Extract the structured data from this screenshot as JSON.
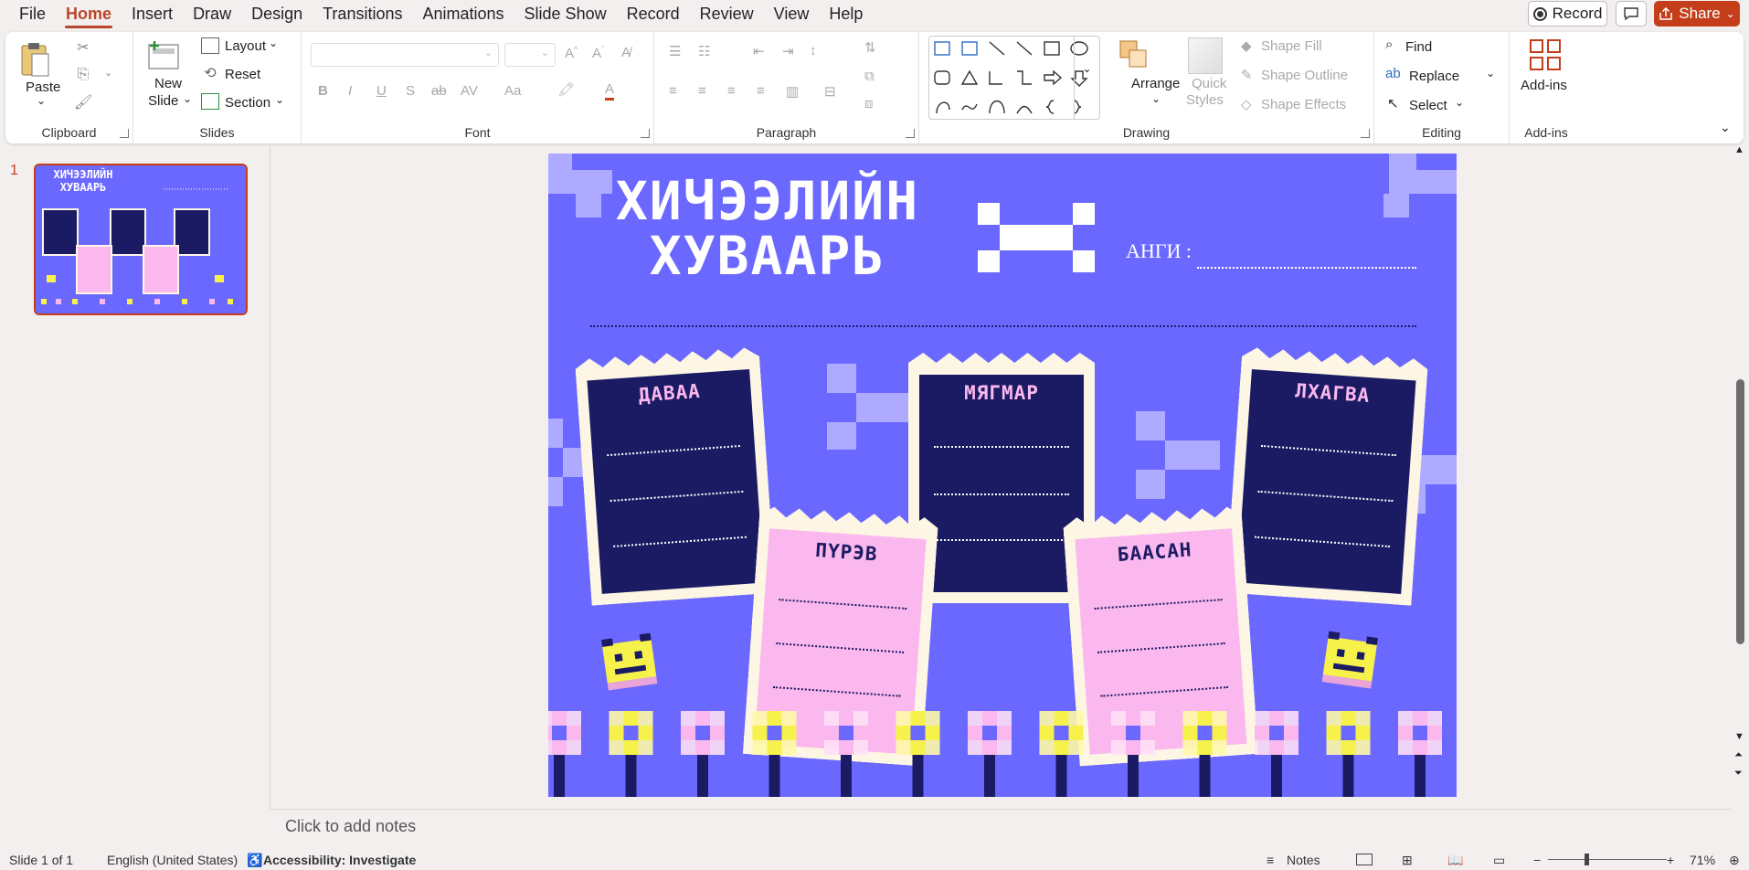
{
  "menu": {
    "tabs": [
      "File",
      "Home",
      "Insert",
      "Draw",
      "Design",
      "Transitions",
      "Animations",
      "Slide Show",
      "Record",
      "Review",
      "View",
      "Help"
    ],
    "active": "Home",
    "record_label": "Record",
    "share_label": "Share"
  },
  "ribbon": {
    "clipboard": {
      "label": "Clipboard",
      "paste": "Paste"
    },
    "slides": {
      "label": "Slides",
      "new_slide_1": "New",
      "new_slide_2": "Slide",
      "layout": "Layout",
      "reset": "Reset",
      "section": "Section"
    },
    "font": {
      "label": "Font",
      "bold": "B",
      "italic": "I",
      "underline": "U",
      "strike": "S",
      "abc": "ab",
      "av": "AV",
      "aa": "Aa"
    },
    "paragraph": {
      "label": "Paragraph"
    },
    "drawing": {
      "label": "Drawing",
      "arrange": "Arrange",
      "quick_styles_1": "Quick",
      "quick_styles_2": "Styles",
      "shape_fill": "Shape Fill",
      "shape_outline": "Shape Outline",
      "shape_effects": "Shape Effects"
    },
    "editing": {
      "label": "Editing",
      "find": "Find",
      "replace": "Replace",
      "select": "Select"
    },
    "addins": {
      "label": "Add-ins",
      "button": "Add-ins"
    }
  },
  "thumbnail": {
    "number": "1"
  },
  "slide": {
    "title_line1": "ХИЧЭЭЛИЙН",
    "title_line2": "ХУВААРЬ",
    "class_label": "АНГИ :",
    "days": [
      "ДАВАА",
      "МЯГМАР",
      "ЛХАГВА",
      "ПҮРЭВ",
      "БААСАН"
    ]
  },
  "notes": {
    "placeholder": "Click to add notes"
  },
  "status": {
    "slide_info": "Slide 1 of 1",
    "language": "English (United States)",
    "accessibility": "Accessibility: Investigate",
    "notes_btn": "Notes",
    "zoom": "71%"
  },
  "colors": {
    "accent": "#c43e1c",
    "slide_bg": "#6b68ff",
    "navy_card": "#1b1b63",
    "pink_card": "#fbb8ee",
    "yellow": "#f7f24b"
  }
}
